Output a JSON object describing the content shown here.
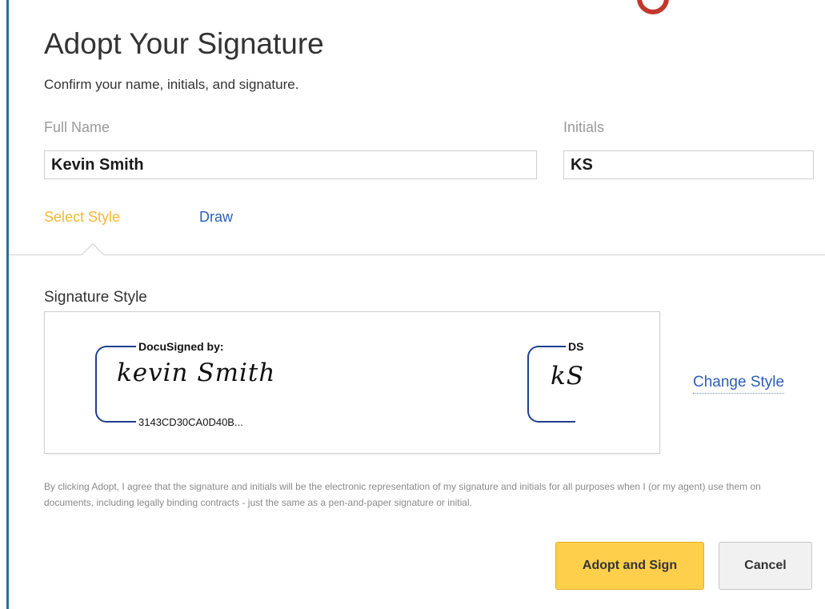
{
  "dialog": {
    "title": "Adopt Your Signature",
    "subtitle": "Confirm your name, initials, and signature."
  },
  "fields": {
    "full_name_label": "Full Name",
    "full_name_value": "Kevin Smith",
    "initials_label": "Initials",
    "initials_value": "KS"
  },
  "tabs": [
    {
      "label": "Select Style",
      "active": true
    },
    {
      "label": "Draw",
      "active": false
    }
  ],
  "signature": {
    "section_label": "Signature Style",
    "signed_by_header": "DocuSigned by:",
    "name_script": "kevin Smith",
    "signature_id": "3143CD30CA0D40B...",
    "initials_header": "DS",
    "initials_script": "kS",
    "change_style_label": "Change Style"
  },
  "legal_text": "By clicking Adopt, I agree that the signature and initials will be the electronic representation of my signature and initials for all purposes when I (or my agent) use them on documents, including legally binding contracts - just the same as a pen-and-paper signature or initial.",
  "buttons": {
    "adopt_label": "Adopt and Sign",
    "cancel_label": "Cancel"
  },
  "colors": {
    "accent_yellow": "#fecf4b",
    "active_tab": "#f7b733",
    "link_blue": "#2b5fb5",
    "signature_bracket": "#1f3f8f"
  }
}
